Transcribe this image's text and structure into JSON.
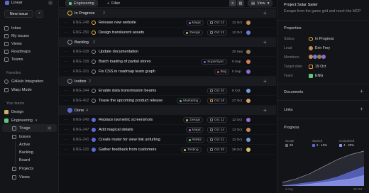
{
  "app": {
    "name": "Linear"
  },
  "sidebar": {
    "new_issue": "New issue",
    "nav": [
      {
        "label": "Inbox",
        "icon": "inbox-icon"
      },
      {
        "label": "My issues",
        "icon": "my-issues-icon"
      },
      {
        "label": "Views",
        "icon": "views-icon"
      },
      {
        "label": "Roadmaps",
        "icon": "roadmaps-icon"
      },
      {
        "label": "Teams",
        "icon": "teams-icon"
      }
    ],
    "favorites_heading": "Favorites",
    "favorites": [
      {
        "label": "GitHub Integration",
        "icon": "github-icon"
      },
      {
        "label": "Warp Mode",
        "icon": "warp-icon"
      }
    ],
    "teams_heading": "Your teams",
    "teams": [
      {
        "label": "Design",
        "color": "#c9b26a"
      },
      {
        "label": "Engineering",
        "color": "#5ec97b"
      }
    ],
    "team_items": [
      {
        "label": "Triage",
        "badge": "2"
      },
      {
        "label": "Issues"
      },
      {
        "label": "Active"
      },
      {
        "label": "Backlog"
      },
      {
        "label": "Board"
      },
      {
        "label": "Projects"
      },
      {
        "label": "Views"
      }
    ]
  },
  "toolbar": {
    "team_chip": "Engineering",
    "filter": "Filter",
    "view": "View"
  },
  "groups": [
    {
      "label": "In Progress",
      "count": "2",
      "color": "#e0b43d"
    },
    {
      "label": "Backlog",
      "count": "3",
      "color": "#8b8d96"
    },
    {
      "label": "Icebox",
      "count": "2",
      "color": "#8b8d96"
    },
    {
      "label": "Done",
      "count": "4",
      "color": "#5e6ad2"
    }
  ],
  "issues": [
    {
      "id": "ENG-248",
      "title": "Release new website",
      "label": "Magic",
      "label_color": "#b06bd8",
      "date": "Oct 12",
      "created": "12 Oct",
      "status_color": "#e0b43d",
      "avatar": "#c98a5a"
    },
    {
      "id": "ENG-250",
      "title": "Design translucent assets",
      "label": "Design",
      "label_color": "#c9b26a",
      "date": "Oct 12",
      "created": "12 Oct",
      "status_color": "#e0b43d",
      "avatar": "#6c7bd4"
    },
    {
      "id": "ENG-028",
      "title": "Update documentation",
      "label": "",
      "label_color": "",
      "date": "",
      "created": "30 Sep",
      "status_color": "#8b8d96",
      "avatar": "#9a7b5a"
    },
    {
      "id": "ENG-199",
      "title": "Batch loading of partial stores",
      "label": "SuperSync",
      "label_color": "#5e6ad2",
      "date": "",
      "created": "5 Sep",
      "status_color": "#8b8d96",
      "avatar": "#d47f5a"
    },
    {
      "id": "ENG-201",
      "title": "Fix CSS in roadmap team graph",
      "label": "Bug",
      "label_color": "#e0524c",
      "date": "",
      "created": "5 Sep",
      "status_color": "#8b8d96",
      "avatar": "#8b6cd4"
    },
    {
      "id": "ENG-344",
      "title": "Enable data transmission beams",
      "label": "",
      "label_color": "",
      "date": "Oct 20",
      "created": "9 Oct",
      "status_color": "#8b8d96",
      "avatar": "#6ca0d4"
    },
    {
      "id": "ENG-402",
      "title": "Tease the upcoming product release",
      "label": "Marketing",
      "label_color": "#5ec97b",
      "date": "Oct 18",
      "created": "27 Oct",
      "status_color": "#8b8d96",
      "avatar": "#d4a06c"
    },
    {
      "id": "ENG-249",
      "title": "Replace isometric screenshots",
      "label": "Design",
      "label_color": "#c9b26a",
      "date": "Oct 12",
      "created": "12 Oct",
      "status_color": "#5e6ad2",
      "avatar": "#9a6cd4"
    },
    {
      "id": "ENG-247",
      "title": "Add magical details",
      "label": "Magic",
      "label_color": "#b06bd8",
      "date": "Oct 14",
      "created": "12 Oct",
      "status_color": "#5e6ad2",
      "avatar": "#c98a5a"
    },
    {
      "id": "ENG-241",
      "title": "Create router for view link unfurling",
      "label": "#6992",
      "label_color": "#5ec97b",
      "date": "Oct 21",
      "created": "12 Oct",
      "status_color": "#5e6ad2",
      "avatar": "#6c9ad4"
    },
    {
      "id": "ENG-220",
      "title": "Gather feedback from customers",
      "label": "Testing",
      "label_color": "#e0b43d",
      "date": "Oct 20",
      "created": "28 Oct",
      "status_color": "#5e6ad2",
      "avatar": "#d4c06c"
    }
  ],
  "project": {
    "title": "Project Solar Sailer",
    "description": "Escape from the game grid and reach the MCP",
    "properties_heading": "Properties",
    "props": [
      {
        "key": "Status",
        "value": "In Progress",
        "color": "#e0b43d"
      },
      {
        "key": "Lead",
        "value": "Erin Frey",
        "color": "#c98a5a"
      },
      {
        "key": "Members",
        "value": "",
        "color": ""
      },
      {
        "key": "Target date",
        "value": "19 Oct",
        "color": "#e88d3d"
      },
      {
        "key": "Team",
        "value": "ENG",
        "color": "#5ec97b"
      }
    ],
    "documents": "Documents",
    "links": "Links",
    "progress": "Progress",
    "legend": [
      {
        "label": "Scope",
        "value": "20",
        "color": "#6b6e78"
      },
      {
        "label": "Started",
        "value": "2 · 10%",
        "color": "#5e6ad2"
      },
      {
        "label": "Completed",
        "value": "4 · 20%",
        "color": "#8f97e8"
      }
    ]
  },
  "chart_data": {
    "type": "area",
    "x": [
      "1 Aug",
      "",
      "",
      "",
      "",
      "",
      "30 Oct"
    ],
    "series": [
      {
        "name": "Scope",
        "values": [
          2,
          4,
          7,
          11,
          15,
          18,
          20
        ]
      },
      {
        "name": "Started",
        "values": [
          0,
          1,
          2,
          3,
          5,
          8,
          11
        ]
      },
      {
        "name": "Completed",
        "values": [
          0,
          0,
          1,
          2,
          3,
          4,
          6
        ]
      }
    ],
    "xlabels": [
      "4 Aug",
      "20 Oct"
    ]
  }
}
